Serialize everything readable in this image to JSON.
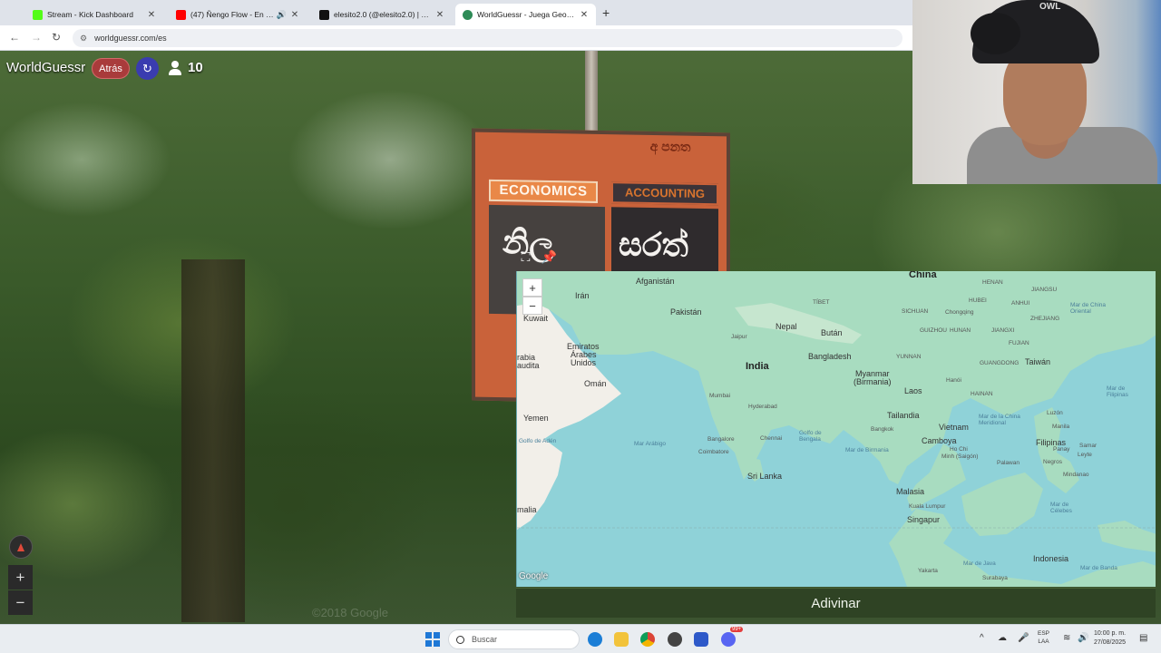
{
  "browser": {
    "tabs": [
      {
        "title": "Stream - Kick Dashboard",
        "icon": "kick-icon",
        "color": "#53fc18"
      },
      {
        "title": "(47) Ñengo Flow - En Las N",
        "icon": "youtube-icon",
        "color": "#ff0000"
      },
      {
        "title": "elesito2.0 (@elesito2.0) | TikTok",
        "icon": "tiktok-icon",
        "color": "#111111"
      },
      {
        "title": "WorldGuessr - Juega GeoGuess",
        "icon": "worldguessr-icon",
        "color": "#2e8b57"
      }
    ],
    "active_tab": 3,
    "url": "worldguessr.com/es"
  },
  "streetview": {
    "sign_header": "අ පනත",
    "sign_label_left": "ECONOMICS",
    "sign_label_right": "ACCOUNTING",
    "sign_glyph_left": "නිල",
    "sign_glyph_right": "සරත්",
    "watermark": "©2018 Google"
  },
  "game": {
    "brand": "WorldGuessr",
    "back_label": "Atrás",
    "player_count": "10",
    "guess_label": "Adivinar"
  },
  "map": {
    "zoom_in": "+",
    "zoom_out": "−",
    "google_mark": "Google",
    "labels": {
      "china": "China",
      "afganistan": "Afganistán",
      "iran": "Irán",
      "pakistan": "Pakistán",
      "kuwait": "Kuwait",
      "nepal": "Nepal",
      "butan": "Bután",
      "india": "India",
      "bangladesh": "Bangladesh",
      "emiratos": "Emiratos",
      "arabes": "Árabes",
      "unidos": "Unidos",
      "arabia1": "rabia",
      "arabia2": "audita",
      "oman": "Omán",
      "myanmar": "Myanmar",
      "birmania": "(Birmania)",
      "laos": "Laos",
      "taiwan": "Taiwán",
      "yemen": "Yemen",
      "mumbai": "Mumbai",
      "hyderabad": "Hyderabad",
      "tailandia": "Tailandia",
      "vietnam": "Vietnam",
      "bangalore": "Bangalore",
      "chennai": "Chennai",
      "bangkok": "Bangkok",
      "camboya": "Camboya",
      "filipinas": "Filipinas",
      "coimbatore": "Coimbatore",
      "srilanka": "Sri Lanka",
      "hochiminh1": "Ho Chi",
      "hochiminh2": "Minh (Saigón)",
      "malasia": "Malasia",
      "kualalumpur": "Kuala Lumpur",
      "singapur": "Singapur",
      "somalia": "malia",
      "indonesia": "Indonesia",
      "yakarta": "Yakarta",
      "surabaya": "Surabaya",
      "jaipur": "Jaipur",
      "chongqing": "Chongqing",
      "hanoi": "Hanói",
      "manila": "Manila",
      "golfo_aden": "Golfo de Adén",
      "mar_arabigo": "Mar Arábigo",
      "golfo_bengala": "Golfo de Bengala",
      "mar_birmania": "Mar de Birmania",
      "mar_china": "Mar de la China Meridional",
      "mar_filipinas": "Mar de Filipinas",
      "mar_china_oriental": "Mar de China Oriental",
      "mar_celebes": "Mar de Célebes",
      "mar_java": "Mar de Java",
      "mar_banda": "Mar de Banda",
      "tibet": "TÍBET",
      "sichuan": "SICHUAN",
      "yunnan": "YUNNAN",
      "guangdong": "GUANGDONG",
      "hainan": "HAINAN",
      "palawan": "Palawan",
      "negros": "Negros",
      "mindanao": "Mindanao",
      "hubei": "HUBEI",
      "anhui": "ANHUI",
      "jiangsu": "JIANGSU",
      "zhejiang": "ZHEJIANG",
      "henan": "HENAN",
      "guizhou": "GUIZHOU",
      "hunan": "HUNAN",
      "jiangxi": "JIANGXI",
      "fujian": "FUJIAN",
      "luzon": "Luzón",
      "panay": "Panay",
      "leyte": "Leyte",
      "samar": "Samar"
    }
  },
  "taskbar": {
    "search_placeholder": "Buscar",
    "lang_line1": "ESP",
    "lang_line2": "LAA",
    "time": "10:00 p. m.",
    "date": "27/08/2025",
    "discord_badge": "99+"
  },
  "webcam": {
    "cap_text": "OWL"
  }
}
